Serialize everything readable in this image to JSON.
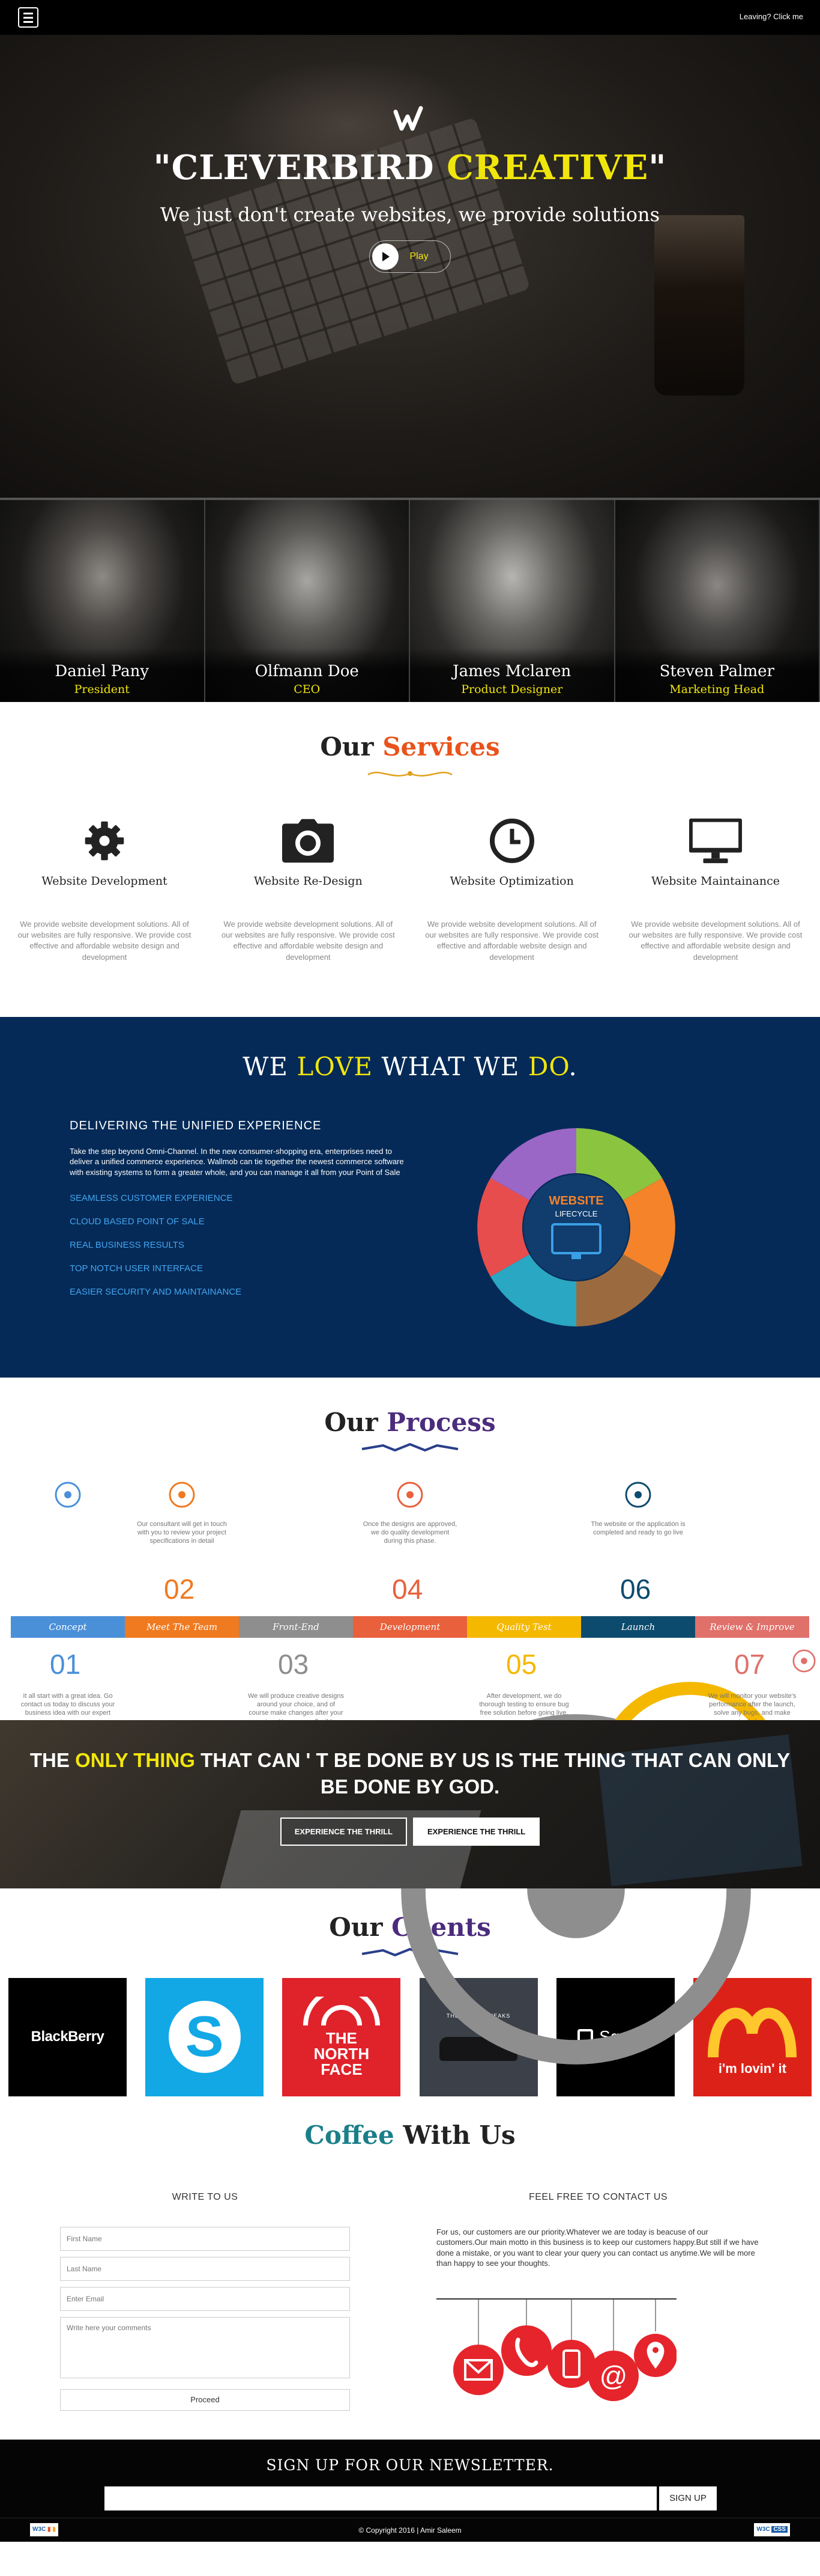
{
  "topbar": {
    "menu_icon": "hamburger-icon",
    "leaving": "Leaving? Click me"
  },
  "hero": {
    "title_pre": "\"CLEVERBIRD ",
    "title_hl": "CREATIVE",
    "title_post": "\"",
    "subtitle": "We just don't create websites, we provide solutions",
    "play": "Play",
    "accent": "#f1e60c"
  },
  "team": [
    {
      "name": "Daniel Pany",
      "role": "President"
    },
    {
      "name": "Olfmann Doe",
      "role": "CEO"
    },
    {
      "name": "James Mclaren",
      "role": "Product Designer"
    },
    {
      "name": "Steven Palmer",
      "role": "Marketing Head"
    }
  ],
  "services": {
    "title_a": "Our ",
    "title_b": "Services",
    "items": [
      {
        "icon": "gear-icon",
        "title": "Website Development",
        "text": "We provide website development solutions. All of our websites are fully responsive. We provide cost effective and affordable website design and development"
      },
      {
        "icon": "camera-icon",
        "title": "Website Re-Design",
        "text": "We provide website development solutions. All of our websites are fully responsive. We provide cost effective and affordable website design and development"
      },
      {
        "icon": "clock-icon",
        "title": "Website Optimization",
        "text": "We provide website development solutions. All of our websites are fully responsive. We provide cost effective and affordable website design and development"
      },
      {
        "icon": "monitor-icon",
        "title": "Website Maintainance",
        "text": "We provide website development solutions. All of our websites are fully responsive. We provide cost effective and affordable website design and development"
      }
    ]
  },
  "love": {
    "t1": "WE ",
    "t2": "LOVE",
    "t3": " WHAT WE ",
    "t4": "DO",
    "t5": ".",
    "heading": "DELIVERING THE UNIFIED EXPERIENCE",
    "text": "Take the step beyond Omni-Channel. In the new consumer-shopping era, enterprises need to deliver a unified commerce experience. Wallmob can tie together the newest commerce software with existing systems to form a greater whole, and you can manage it all from your Point of Sale",
    "list": [
      "SEAMLESS CUSTOMER EXPERIENCE",
      "CLOUD BASED POINT OF SALE",
      "REAL BUSINESS RESULTS",
      "TOP NOTCH USER INTERFACE",
      "EASIER SECURITY AND MAINTAINANCE"
    ],
    "wheel_title": "WEBSITE",
    "wheel_sub": "LIFECYCLE"
  },
  "process": {
    "title_a": "Our ",
    "title_b": "Process",
    "steps": [
      {
        "num": "01",
        "label": "Concept",
        "text": "It all start with a great idea. Go contact us today to discuss your business idea with our expert team",
        "color": "#4a90d9"
      },
      {
        "num": "02",
        "label": "Meet The Team",
        "text": "Our consultant will get in touch with you to review your project specifications in detail",
        "color": "#f07a20"
      },
      {
        "num": "03",
        "label": "Front-End",
        "text": "We will produce creative designs around your choice, and of course make changes after your review. Yes, we are flexible",
        "color": "#8e8e8e"
      },
      {
        "num": "04",
        "label": "Development",
        "text": "Once the designs are approved, we do quality development during this phase.",
        "color": "#e8603c"
      },
      {
        "num": "05",
        "label": "Quality Test",
        "text": "After development, we do thorough testing to ensure bug free solution before going live.",
        "color": "#f5b800"
      },
      {
        "num": "06",
        "label": "Launch",
        "text": "The website or the application is completed and ready to go live",
        "color": "#0d4b6e"
      },
      {
        "num": "07",
        "label": "Review & Improve",
        "text": "We will monitor your website's performance after the launch, solve any bugs, and make required changes.",
        "color": "#e0706a"
      }
    ]
  },
  "thrill": {
    "p1": "THE ",
    "p2": "ONLY THING",
    "p3": " THAT CAN ' T BE DONE BY US IS THE THING THAT CAN ONLY BE DONE BY GOD.",
    "btn1": "EXPERIENCE THE THRILL",
    "btn2": "EXPERIENCE THE THRILL"
  },
  "clients": {
    "title_a": "Our ",
    "title_b": "Clients",
    "items": [
      {
        "name": "BlackBerry",
        "bg": "#000000"
      },
      {
        "name": "Skype",
        "bg": "#12a8e6"
      },
      {
        "name": "THE NORTH FACE",
        "bg": "#e0222b"
      },
      {
        "name": "THE STORE SNEAKS",
        "bg": "#3c4149"
      },
      {
        "name": "Square",
        "bg": "#000000"
      },
      {
        "name": "i'm lovin' it",
        "bg": "#dc2218"
      }
    ]
  },
  "coffee": {
    "title_a": "Coffee",
    "title_b": " With Us",
    "write": "WRITE TO US",
    "contact": "FEEL FREE TO CONTACT US",
    "first_name": "First Name",
    "last_name": "Last Name",
    "email": "Enter Email",
    "comments": "Write here your comments",
    "proceed": "Proceed",
    "contact_text": "For us, our customers are our priority.Whatever we are today is beacuse of our customers.Our main motto in this business is to keep our customers happy.But still if we have done a mistake, or you want to clear your query you can contact us anytime.We will be more than happy to see your thoughts.",
    "tag_icons": [
      "mail-icon",
      "phone-icon",
      "mobile-icon",
      "at-icon",
      "location-icon"
    ]
  },
  "footer": {
    "newsletter": "SIGN UP FOR OUR NEWSLETTER.",
    "signup": "SIGN UP",
    "copyright": "© Copyright 2016 | Amir Saleem",
    "w3c": "W3C",
    "css": "CSS"
  }
}
